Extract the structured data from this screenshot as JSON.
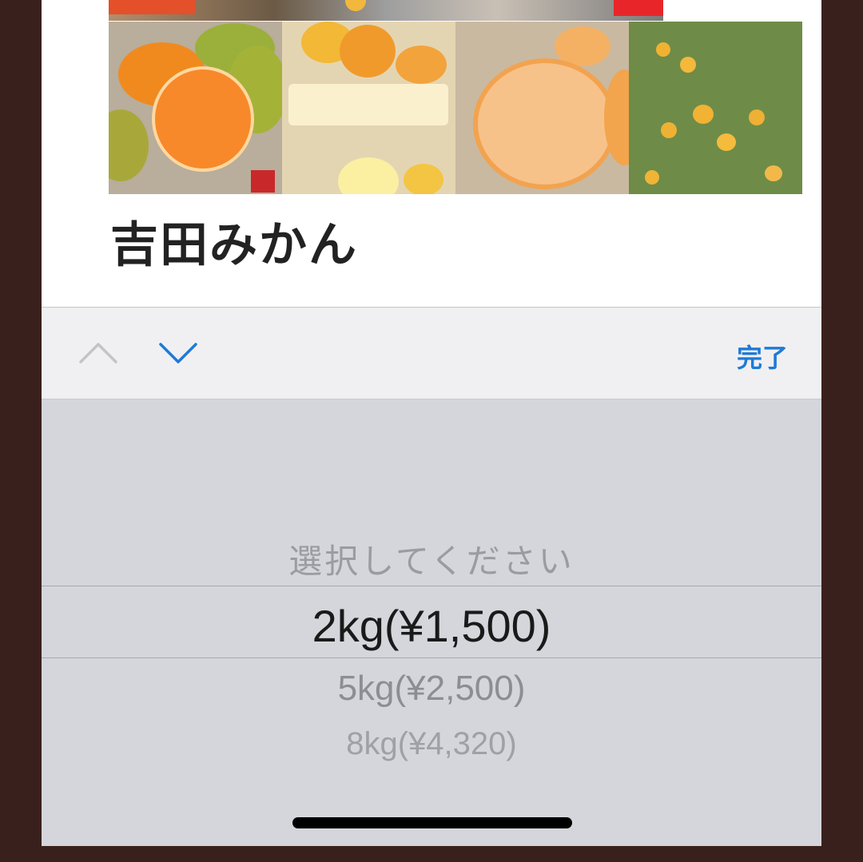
{
  "product": {
    "title": "吉田みかん"
  },
  "toolbar": {
    "prev_icon": "chevron-up-icon",
    "next_icon": "chevron-down-icon",
    "done_label": "完了",
    "accent_color": "#1e7ad6"
  },
  "picker": {
    "options": [
      "選択してください",
      "2kg(¥1,500)",
      "5kg(¥2,500)",
      "8kg(¥4,320)"
    ],
    "selected_index": 1
  }
}
